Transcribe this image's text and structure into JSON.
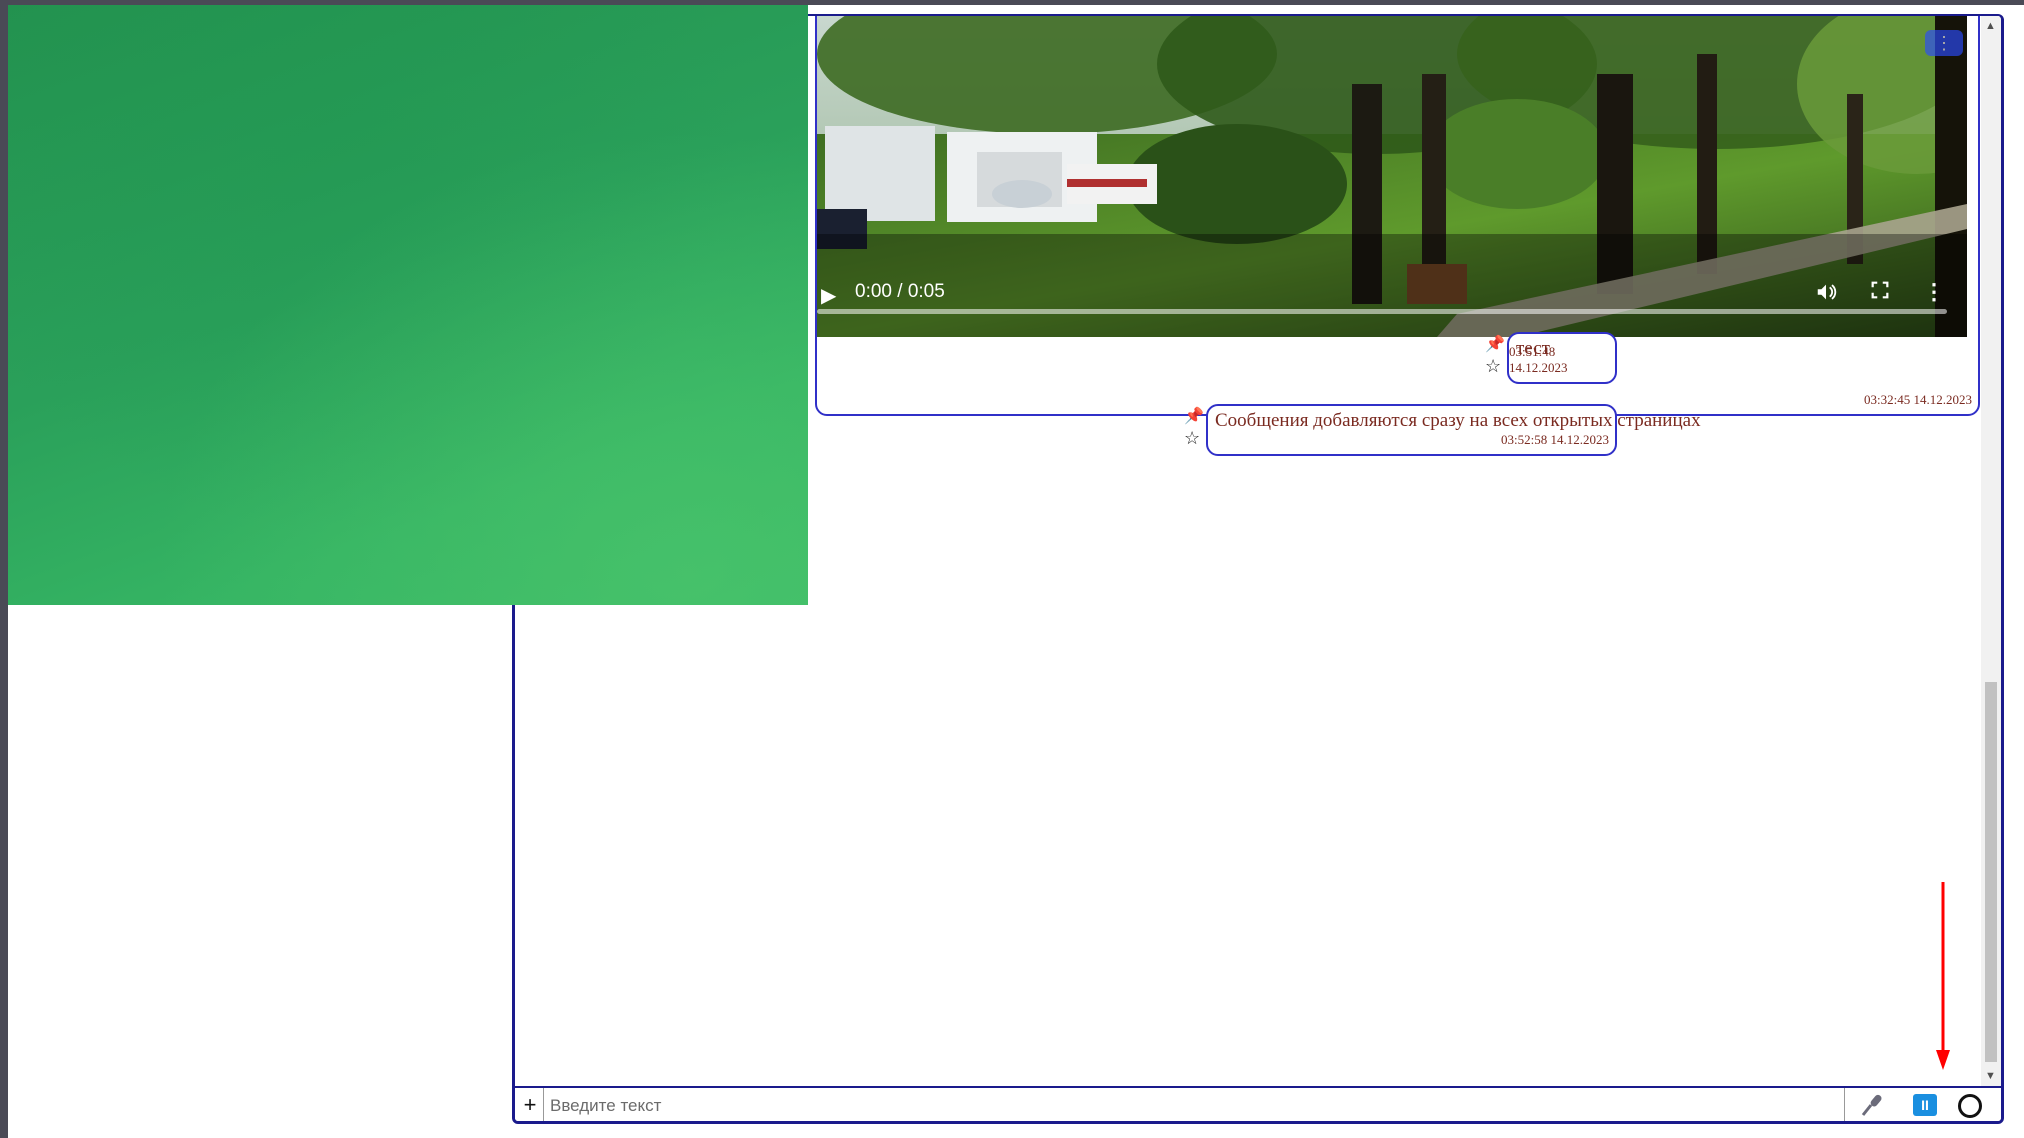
{
  "video_message": {
    "time_display": "0:00 / 0:05",
    "timestamp": "03:32:45 14.12.2023",
    "icons": {
      "play": "play-icon",
      "volume": "volume-icon",
      "fullscreen": "fullscreen-icon",
      "more": "more-vert-icon",
      "menu_chip": "more-vert-icon"
    }
  },
  "messages": [
    {
      "text": "тест",
      "timestamp": "03:51:48 14.12.2023",
      "pin_icon": "📌",
      "star_icon": "☆"
    },
    {
      "text": "Сообщения добавляются сразу на всех открытых страницах",
      "timestamp": "03:52:58 14.12.2023",
      "pin_icon": "📌",
      "star_icon": "☆"
    }
  ],
  "input_bar": {
    "attach_label": "+",
    "placeholder": "Введите текст",
    "pause_label": "II",
    "icons": {
      "mic": "microphone-icon",
      "pause": "pause-icon",
      "record": "record-circle-icon"
    }
  },
  "scrollbar": {
    "up_arrow": "▲",
    "down_arrow": "▼"
  },
  "colors": {
    "border": "#1a1a8c",
    "bubble_border": "#3030c8",
    "message_text": "#7a2a20",
    "pin": "#e02020",
    "pause_button": "#1a8fe0",
    "annotation_arrow": "#ff0000",
    "camera_green": "#2aa05a"
  }
}
